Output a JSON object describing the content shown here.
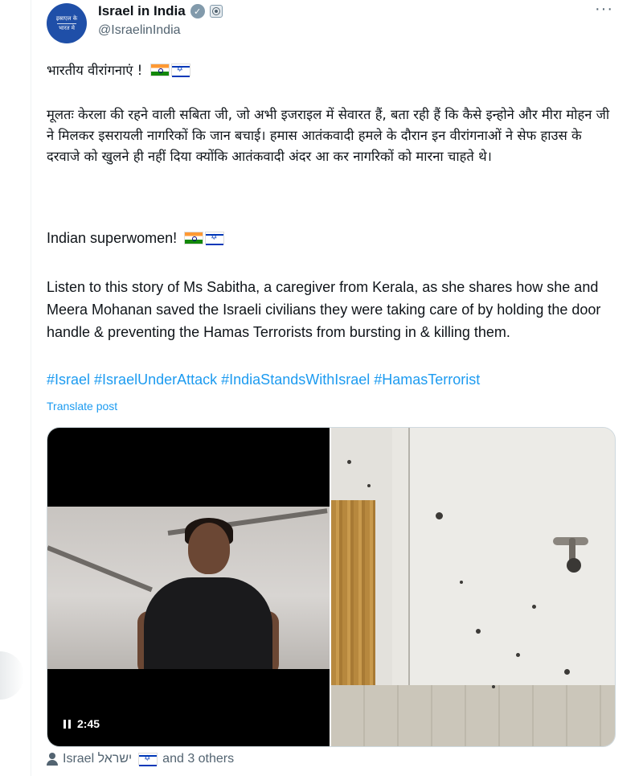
{
  "author": {
    "display_name": "Israel in India",
    "handle": "@IsraelinIndia",
    "avatar_text_line1": "इस्राएल के",
    "avatar_text_line2": "भारत मे"
  },
  "more_icon": "···",
  "post": {
    "hindi_heading": "भारतीय वीरांगनाएं !",
    "hindi_body": "मूलतः केरला की रहने वाली सबिता जी, जो अभी इजराइल में सेवारत हैं, बता रही हैं कि कैसे इन्होने और मीरा मोहन जी ने मिलकर इसरायली नागरिकों कि जान बचाई। हमास आतंकवादी हमले के दौरान इन वीरांगनाओं ने सेफ हाउस के दरवाजे को खुलने ही नहीं दिया क्योंकि आतंकवादी अंदर आ कर नागरिकों को मारना चाहते थे।",
    "english_heading": "Indian superwomen!",
    "english_body": "Listen to this story of Ms Sabitha, a caregiver from Kerala, as she shares how she and Meera Mohanan saved the Israeli civilians they were taking care of by holding the door handle & preventing the Hamas Terrorists from bursting in & killing them.",
    "hashtags": [
      "#Israel",
      "#IsraelUnderAttack",
      "#IndiaStandsWithIsrael",
      "#HamasTerrorist"
    ],
    "translate_label": "Translate post"
  },
  "media": {
    "video_time": "2:45"
  },
  "footer": {
    "tagged_prefix": "Israel ישראל",
    "tagged_suffix": "and 3 others"
  },
  "icons": {
    "verified": "verified-badge-icon",
    "affiliation": "affiliation-badge-icon",
    "pause": "pause-icon",
    "person": "person-icon"
  },
  "colors": {
    "link": "#1d9bf0",
    "secondary_text": "#536471",
    "primary_text": "#0f1419"
  }
}
